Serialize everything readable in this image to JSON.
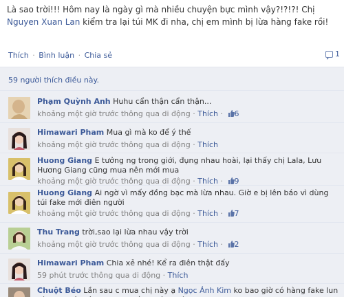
{
  "post": {
    "text_before": "Là sao trời!!! Hôm nay là ngày gì mà nhiều chuyện bực mình vậy?!?!?! Chị ",
    "mention": "Nguyen Xuan Lan",
    "text_after": " kiểm tra lại túi MK đi nha, chị em mình bị lừa hàng fake rồi!",
    "actions": [
      "Thích",
      "Bình luận",
      "Chia sẻ"
    ],
    "separator": "·",
    "comment_count": "1"
  },
  "likes_text": "59 người thích điều này.",
  "comments": [
    {
      "author": "Phạm Quỳnh Anh",
      "text": "Huhu cẩn thận cẩn thận...",
      "time": "khoảng một giờ trước thông qua di động",
      "like_label": "Thích",
      "like_count": "6",
      "avatar_bg": "#d9c9a8"
    },
    {
      "author": "Himawari Pham",
      "text": "Mua gì mà ko để ý thế",
      "time": "khoảng một giờ trước thông qua di động",
      "like_label": "Thích",
      "like_count": "",
      "avatar_bg": "#6b4a4a"
    },
    {
      "author": "Huong Giang",
      "text": "E tưởng ng trong giới, đụng nhau hoài, lại thấy chị Lala, Lưu Hương Giang cũng mua nên mới mua",
      "time": "khoảng một giờ trước thông qua di động",
      "like_label": "Thích",
      "like_count": "9",
      "avatar_bg": "#c8a046"
    },
    {
      "author": "Huong Giang",
      "text": "Ai ngờ vì mấy đồng bạc mà lừa nhau. Giờ e bị lên báo vì dùng túi fake mới điên người",
      "time": "khoảng một giờ trước thông qua di động",
      "like_label": "Thích",
      "like_count": "7",
      "avatar_bg": "#c8a046"
    },
    {
      "author": "Thu Trang",
      "text": "trời,sao lại lừa nhau vậy trời",
      "time": "khoảng một giờ trước thông qua di động",
      "like_label": "Thích",
      "like_count": "2",
      "avatar_bg": "#9fb87a"
    },
    {
      "author": "Himawari Pham",
      "text": "Chia xẻ nhé! Kể ra điên thật đấy",
      "time": "59 phút trước thông qua di động",
      "like_label": "Thích",
      "like_count": "",
      "avatar_bg": "#6b4a4a"
    },
    {
      "author": "Chuột Béo",
      "text_before": "Lần sau c mua chị này ạ ",
      "mention": "Ngọc Ánh Kim",
      "text_after": " ko bao giờ có hàng fake lun nè. E Chuột yêu thương c ấy nhiều nhé",
      "time": "",
      "like_label": "",
      "like_count": "",
      "avatar_bg": "#8a7a6a"
    }
  ]
}
